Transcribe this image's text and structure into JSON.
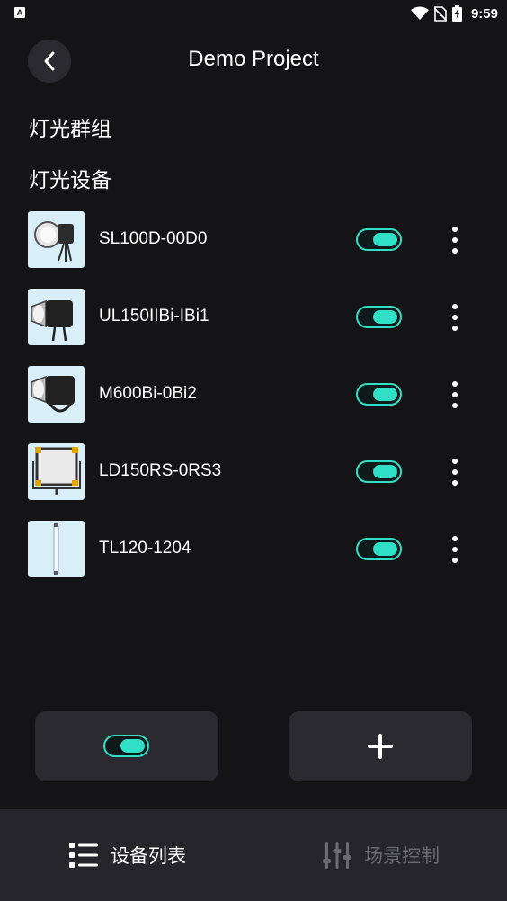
{
  "status_bar": {
    "left_icon": "A",
    "time": "9:59",
    "icons": [
      "wifi-icon",
      "no-sim-icon",
      "battery-charging-icon"
    ]
  },
  "header": {
    "title": "Demo Project",
    "back_icon": "chevron-left-icon"
  },
  "sections": {
    "groups_title": "灯光群组",
    "devices_title": "灯光设备"
  },
  "devices": [
    {
      "name": "SL100D-00D0",
      "enabled": true,
      "thumb": "spotlight"
    },
    {
      "name": "UL150IIBi-IBi1",
      "enabled": true,
      "thumb": "cob-light"
    },
    {
      "name": "M600Bi-0Bi2",
      "enabled": true,
      "thumb": "cob-light"
    },
    {
      "name": "LD150RS-0RS3",
      "enabled": true,
      "thumb": "panel-light"
    },
    {
      "name": "TL120-1204",
      "enabled": true,
      "thumb": "tube-light"
    }
  ],
  "actions": {
    "master_toggle": true,
    "add_icon": "plus-icon"
  },
  "bottom_nav": {
    "items": [
      {
        "label": "设备列表",
        "icon": "list-icon",
        "active": true
      },
      {
        "label": "场景控制",
        "icon": "sliders-icon",
        "active": false
      }
    ]
  },
  "colors": {
    "background": "#141416",
    "accent": "#2fe0c6",
    "card": "#2a2a30",
    "nav_background": "#26252c",
    "inactive_text": "#6b6a72"
  }
}
